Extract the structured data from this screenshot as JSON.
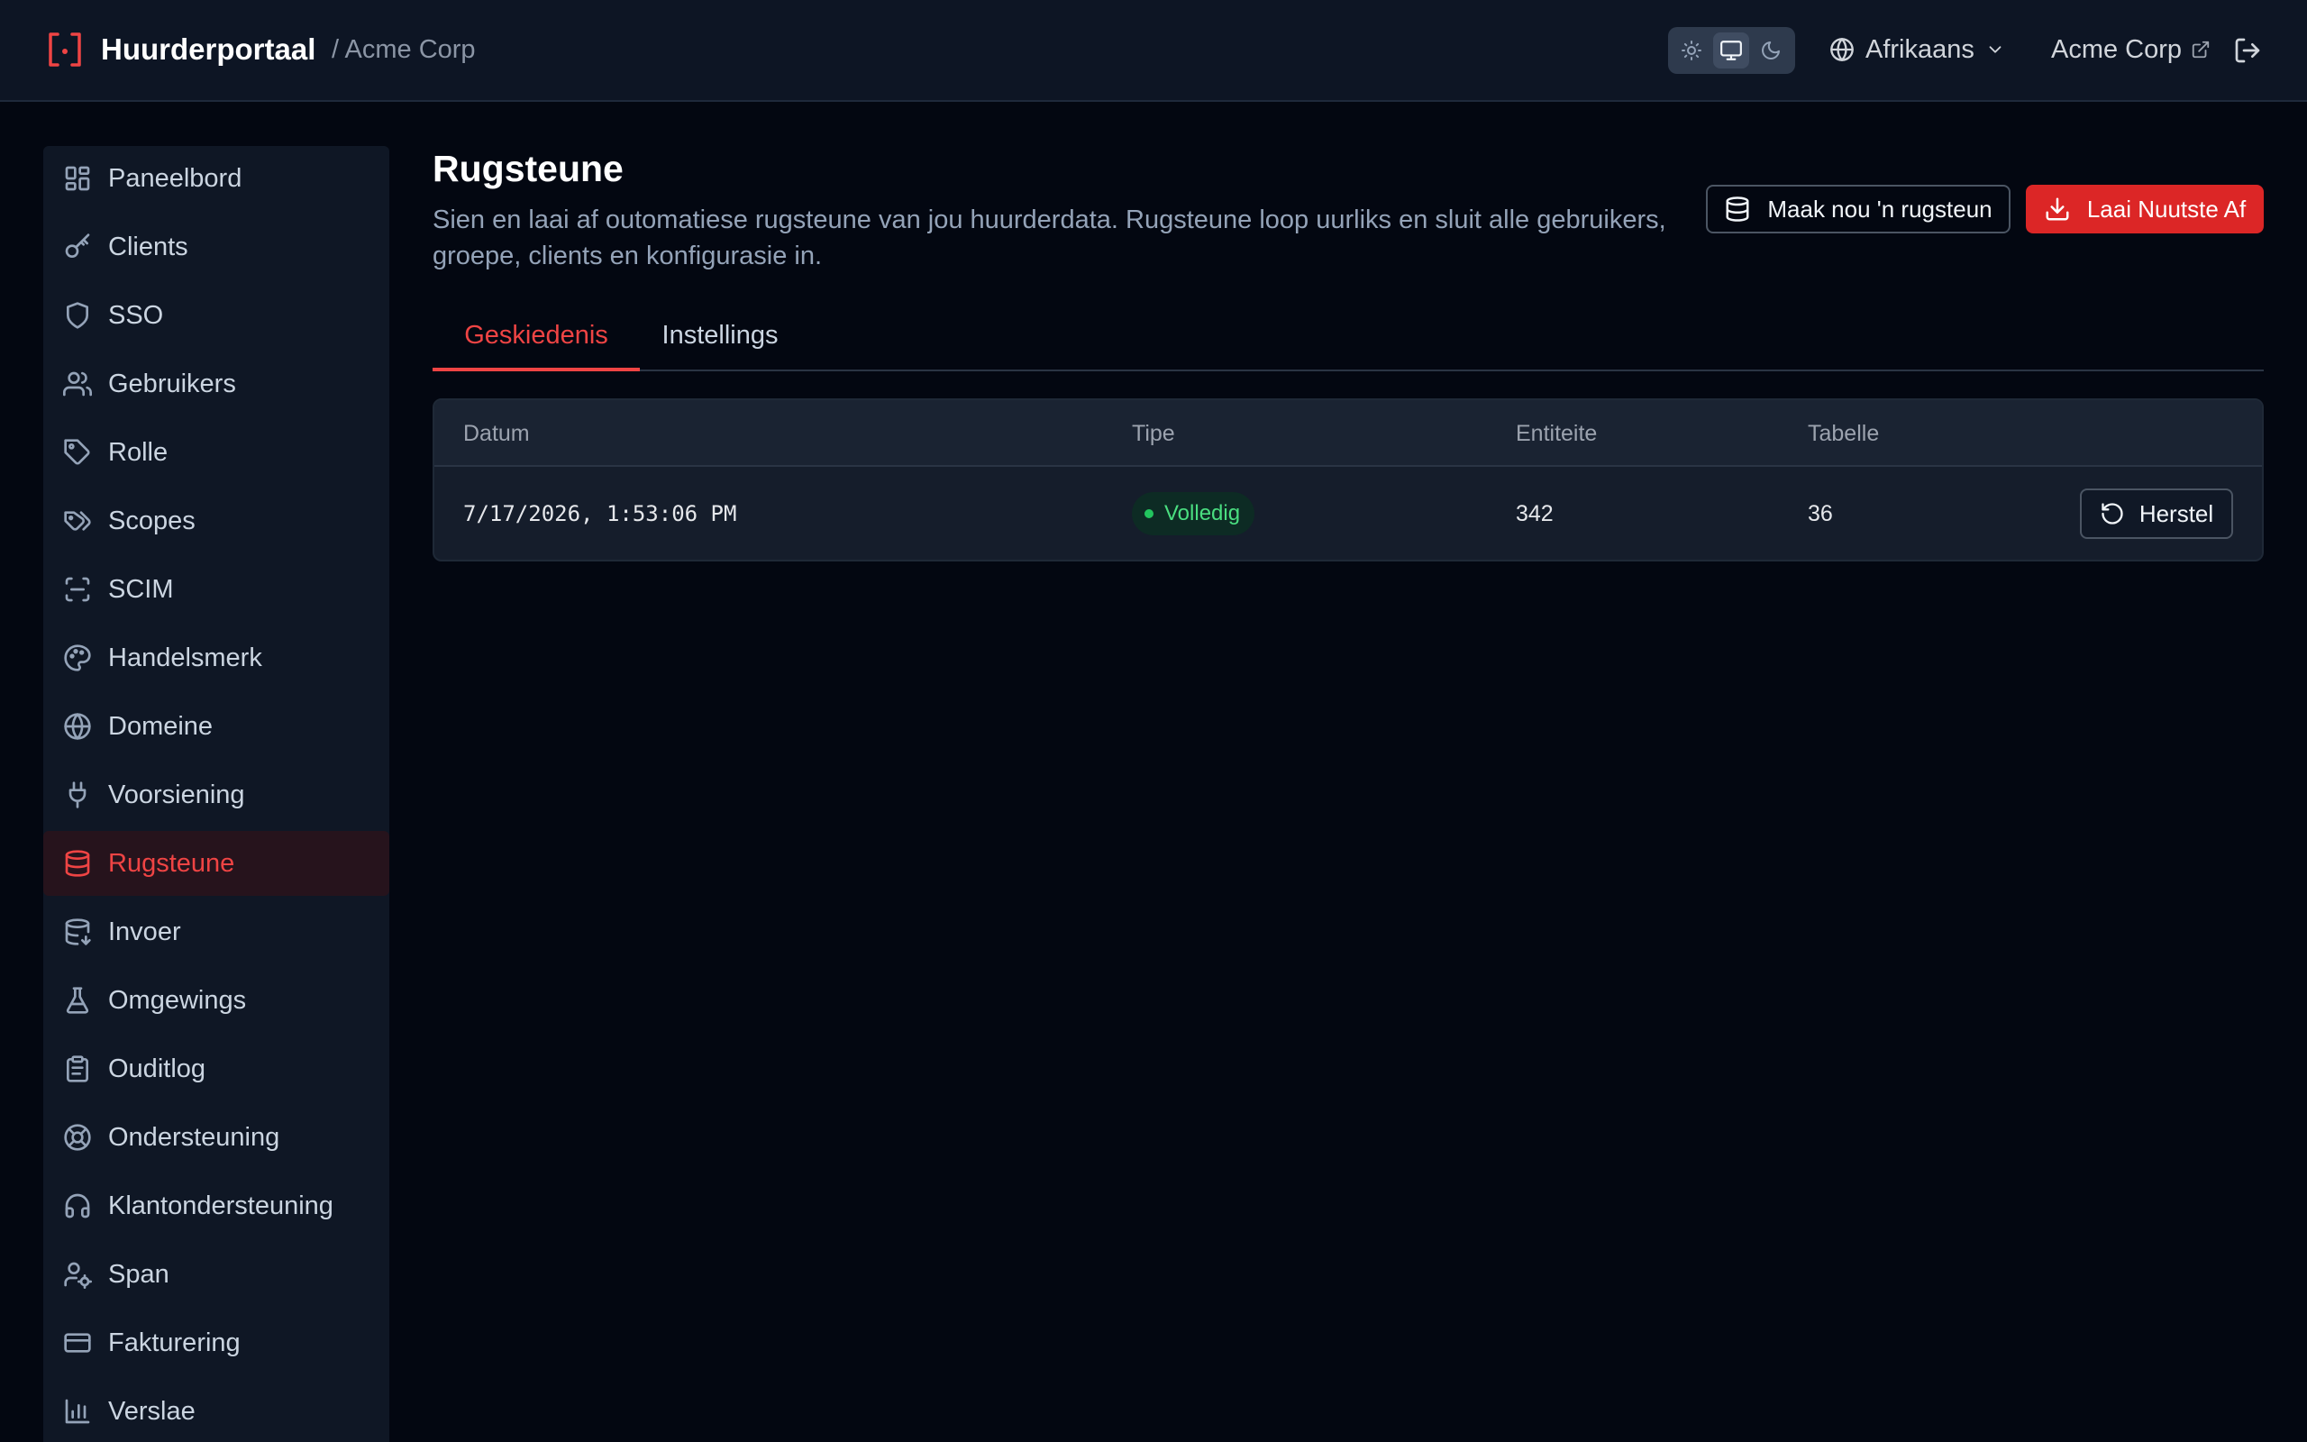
{
  "header": {
    "brand": "Huurderportaal",
    "breadcrumb": "/ Acme Corp",
    "language": "Afrikaans",
    "tenant": "Acme Corp",
    "theme_options": [
      "sun-icon",
      "monitor-icon",
      "moon-icon"
    ],
    "theme_selected": "monitor-icon"
  },
  "sidebar": {
    "items": [
      {
        "label": "Paneelbord",
        "icon": "dashboard-icon"
      },
      {
        "label": "Clients",
        "icon": "key-icon"
      },
      {
        "label": "SSO",
        "icon": "shield-icon"
      },
      {
        "label": "Gebruikers",
        "icon": "users-icon"
      },
      {
        "label": "Rolle",
        "icon": "tag-icon"
      },
      {
        "label": "Scopes",
        "icon": "tags-icon"
      },
      {
        "label": "SCIM",
        "icon": "scan-icon"
      },
      {
        "label": "Handelsmerk",
        "icon": "palette-icon"
      },
      {
        "label": "Domeine",
        "icon": "globe-icon"
      },
      {
        "label": "Voorsiening",
        "icon": "plug-icon"
      },
      {
        "label": "Rugsteune",
        "icon": "database-icon",
        "active": true
      },
      {
        "label": "Invoer",
        "icon": "database-import-icon"
      },
      {
        "label": "Omgewings",
        "icon": "flask-icon"
      },
      {
        "label": "Ouditlog",
        "icon": "clipboard-icon"
      },
      {
        "label": "Ondersteuning",
        "icon": "lifebuoy-icon"
      },
      {
        "label": "Klantondersteuning",
        "icon": "headphones-icon"
      },
      {
        "label": "Span",
        "icon": "user-cog-icon"
      },
      {
        "label": "Fakturering",
        "icon": "credit-card-icon"
      },
      {
        "label": "Verslae",
        "icon": "bar-chart-icon"
      }
    ]
  },
  "main": {
    "title": "Rugsteune",
    "description": "Sien en laai af outomatiese rugsteune van jou huurderdata. Rugsteune loop uurliks en sluit alle gebruikers, groepe, clients en konfigurasie in.",
    "create_button": "Maak nou 'n rugsteun",
    "download_button": "Laai Nuutste Af",
    "tabs": [
      {
        "label": "Geskiedenis",
        "active": true
      },
      {
        "label": "Instellings",
        "active": false
      }
    ],
    "table": {
      "headers": [
        "Datum",
        "Tipe",
        "Entiteite",
        "Tabelle"
      ],
      "rows": [
        {
          "date": "7/17/2026, 1:53:06 PM",
          "type": "Volledig",
          "entities": "342",
          "tables": "36",
          "action": "Herstel"
        }
      ]
    }
  },
  "colors": {
    "accent": "#ef4444",
    "primary_button": "#dc2626",
    "success": "#22c55e",
    "background": "#030711"
  }
}
